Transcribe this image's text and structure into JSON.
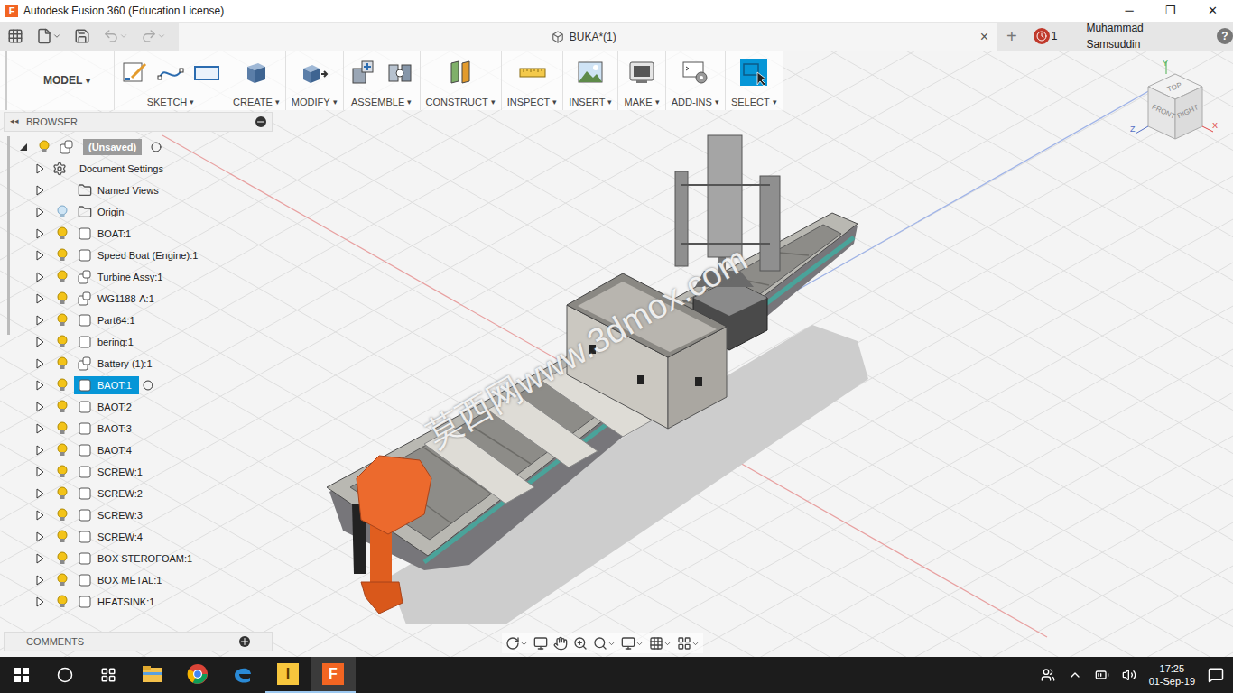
{
  "window": {
    "title": "Autodesk Fusion 360 (Education License)",
    "icon": "F",
    "controls": [
      "─",
      "❐",
      "✕"
    ]
  },
  "quick_access": [
    {
      "kind": "apps"
    },
    {
      "kind": "file"
    },
    {
      "kind": "save"
    },
    {
      "kind": "undo"
    },
    {
      "kind": "redo"
    }
  ],
  "document_tab": {
    "label": "BUKA*(1)",
    "close": "×",
    "new_tab": "+"
  },
  "account": {
    "jobs": "1",
    "user": "Muhammad Samsuddin",
    "help": "?"
  },
  "workspace": {
    "label": "MODEL",
    "caret": "▾"
  },
  "toolbar": {
    "caret": "▾",
    "groups": [
      {
        "label": "SKETCH",
        "selected": false,
        "tools": [
          {
            "kind": "sketch"
          },
          {
            "kind": "line"
          },
          {
            "kind": "rectangle"
          }
        ]
      },
      {
        "label": "CREATE",
        "selected": false,
        "tools": [
          {
            "kind": "extrude"
          }
        ]
      },
      {
        "label": "MODIFY",
        "selected": false,
        "tools": [
          {
            "kind": "press-pull"
          }
        ]
      },
      {
        "label": "ASSEMBLE",
        "selected": false,
        "tools": [
          {
            "kind": "new-component"
          },
          {
            "kind": "joint"
          }
        ]
      },
      {
        "label": "CONSTRUCT",
        "selected": false,
        "tools": [
          {
            "kind": "plane"
          }
        ]
      },
      {
        "label": "INSPECT",
        "selected": false,
        "tools": [
          {
            "kind": "measure"
          }
        ]
      },
      {
        "label": "INSERT",
        "selected": false,
        "tools": [
          {
            "kind": "image"
          }
        ]
      },
      {
        "label": "MAKE",
        "selected": false,
        "tools": [
          {
            "kind": "print"
          }
        ]
      },
      {
        "label": "ADD-INS",
        "selected": false,
        "tools": [
          {
            "kind": "scripts"
          }
        ]
      },
      {
        "label": "SELECT",
        "selected": true,
        "tools": [
          {
            "kind": "select"
          }
        ]
      }
    ]
  },
  "browser": {
    "title": "BROWSER",
    "root": {
      "label": "(Unsaved)",
      "expanded": true
    },
    "items": [
      {
        "label": "Document Settings",
        "kind": "settings",
        "visible": null,
        "selected": false,
        "expanded": false
      },
      {
        "label": "Named Views",
        "kind": "views",
        "visible": null,
        "selected": false,
        "expanded": false
      },
      {
        "label": "Origin",
        "kind": "origin",
        "visible": false,
        "selected": false,
        "expanded": false
      },
      {
        "label": "BOAT:1",
        "kind": "component",
        "visible": true,
        "selected": false,
        "expanded": false
      },
      {
        "label": "Speed Boat (Engine):1",
        "kind": "component",
        "visible": true,
        "selected": false,
        "expanded": false
      },
      {
        "label": "Turbine Assy:1",
        "kind": "assembly",
        "visible": true,
        "selected": false,
        "expanded": false
      },
      {
        "label": "WG1188-A:1",
        "kind": "assembly",
        "visible": true,
        "selected": false,
        "expanded": false
      },
      {
        "label": "Part64:1",
        "kind": "component",
        "visible": true,
        "selected": false,
        "expanded": false
      },
      {
        "label": "bering:1",
        "kind": "component",
        "visible": true,
        "selected": false,
        "expanded": false
      },
      {
        "label": "Battery (1):1",
        "kind": "assembly",
        "visible": true,
        "selected": false,
        "expanded": false
      },
      {
        "label": "BAOT:1",
        "kind": "component",
        "visible": true,
        "selected": true,
        "expanded": false
      },
      {
        "label": "BAOT:2",
        "kind": "component",
        "visible": true,
        "selected": false,
        "expanded": false
      },
      {
        "label": "BAOT:3",
        "kind": "component",
        "visible": true,
        "selected": false,
        "expanded": false
      },
      {
        "label": "BAOT:4",
        "kind": "component",
        "visible": true,
        "selected": false,
        "expanded": false
      },
      {
        "label": "SCREW:1",
        "kind": "component",
        "visible": true,
        "selected": false,
        "expanded": false
      },
      {
        "label": "SCREW:2",
        "kind": "component",
        "visible": true,
        "selected": false,
        "expanded": false
      },
      {
        "label": "SCREW:3",
        "kind": "component",
        "visible": true,
        "selected": false,
        "expanded": false
      },
      {
        "label": "SCREW:4",
        "kind": "component",
        "visible": true,
        "selected": false,
        "expanded": false
      },
      {
        "label": "BOX STEROFOAM:1",
        "kind": "component",
        "visible": true,
        "selected": false,
        "expanded": false
      },
      {
        "label": "BOX METAL:1",
        "kind": "component",
        "visible": true,
        "selected": false,
        "expanded": false
      },
      {
        "label": "HEATSINK:1",
        "kind": "component",
        "visible": true,
        "selected": false,
        "expanded": false
      }
    ]
  },
  "comments": {
    "title": "COMMENTS"
  },
  "viewcube": {
    "top": "TOP",
    "front": "FRONT",
    "right": "RIGHT",
    "x": "X",
    "y": "Y",
    "z": "Z"
  },
  "watermark": "莫西网www.3dmox.com",
  "nav_tools": [
    {
      "kind": "orbit",
      "caret": true
    },
    {
      "kind": "look",
      "caret": false
    },
    {
      "kind": "pan",
      "caret": false
    },
    {
      "kind": "zoom",
      "caret": false
    },
    {
      "kind": "fit",
      "caret": true
    },
    {
      "kind": "display",
      "caret": true
    },
    {
      "kind": "grid",
      "caret": true
    },
    {
      "kind": "viewports",
      "caret": true
    }
  ],
  "taskbar": {
    "apps": [
      {
        "kind": "explorer",
        "glyph": "",
        "running": false,
        "active": false
      },
      {
        "kind": "chrome",
        "glyph": "",
        "running": false,
        "active": false
      },
      {
        "kind": "edge",
        "glyph": "",
        "running": false,
        "active": false
      },
      {
        "kind": "inventor",
        "glyph": "I",
        "running": true,
        "active": false
      },
      {
        "kind": "fusion",
        "glyph": "F",
        "running": true,
        "active": true
      }
    ],
    "time": "17:25",
    "date": "01-Sep-19"
  }
}
